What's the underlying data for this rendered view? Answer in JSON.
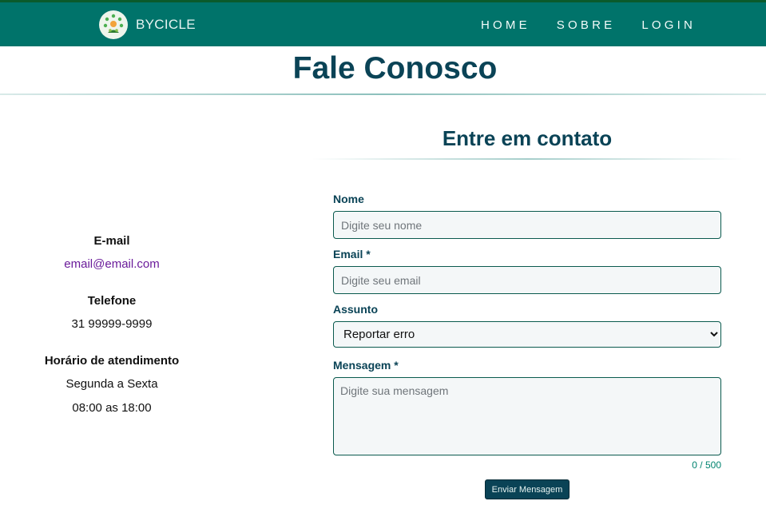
{
  "navbar": {
    "brand": "BYCICLE",
    "links": [
      {
        "label": "HOME"
      },
      {
        "label": "SOBRE"
      },
      {
        "label": "LOGIN"
      }
    ]
  },
  "page_title": "Fale Conosco",
  "contact_info": {
    "email_label": "E-mail",
    "email_value": "email@email.com",
    "phone_label": "Telefone",
    "phone_value": "31 99999-9999",
    "hours_label": "Horário de atendimento",
    "hours_days": "Segunda a Sexta",
    "hours_time": "08:00 as 18:00"
  },
  "form": {
    "title": "Entre em contato",
    "name_label": "Nome",
    "name_placeholder": "Digite seu nome",
    "email_label": "Email *",
    "email_placeholder": "Digite seu email",
    "subject_label": "Assunto",
    "subject_selected": "Reportar erro",
    "message_label": "Mensagem *",
    "message_placeholder": "Digite sua mensagem",
    "char_counter": "0 / 500",
    "submit_label": "Enviar Mensagem"
  },
  "colors": {
    "navbar": "#00736a",
    "heading": "#0a4356",
    "link": "#6a1b9a",
    "counter": "#00836f"
  }
}
